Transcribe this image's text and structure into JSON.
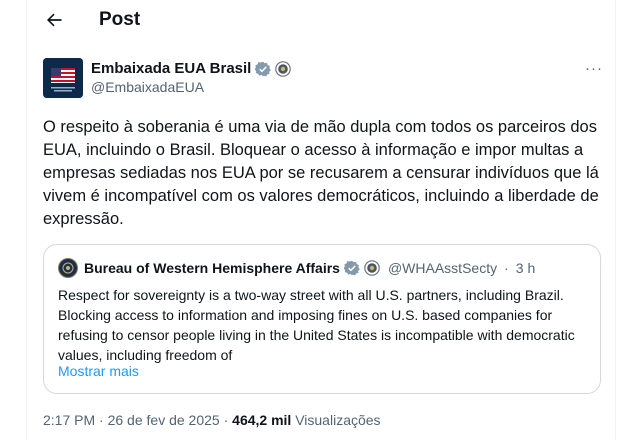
{
  "header": {
    "title": "Post"
  },
  "author": {
    "name": "Embaixada EUA Brasil",
    "handle": "@EmbaixadaEUA"
  },
  "tweet": {
    "text": "O respeito à soberania é uma via de mão dupla com todos os parceiros dos EUA, incluindo o Brasil. Bloquear o acesso à informação e impor multas a empresas sediadas nos EUA por se recusarem a censurar indivíduos que lá vivem é incompatível com os valores democráticos, incluindo a liberdade de expressão."
  },
  "quote": {
    "name": "Bureau of Western Hemisphere Affairs",
    "handle": "@WHAAsstSecty",
    "separator": "·",
    "time": "3 h",
    "text": "Respect for sovereignty is a two-way street with all U.S. partners, including Brazil. Blocking access to information and imposing fines on U.S. based companies for refusing to censor people living in the United States is incompatible with democratic values, including freedom of",
    "show_more": "Mostrar mais"
  },
  "meta": {
    "time": "2:17 PM",
    "separator": "·",
    "date": "26 de fev de 2025",
    "views_count": "464,2 mil",
    "views_label": "Visualizações"
  },
  "colors": {
    "text": "#0f1419",
    "secondary": "#536471",
    "link": "#1d9bf0",
    "border": "#cfd9de",
    "gov_badge": "#829aab"
  },
  "icons": {
    "back": "arrow-left-icon",
    "verified": "gray-verified-badge-icon",
    "seal": "government-seal-icon",
    "more": "more-options-icon"
  }
}
